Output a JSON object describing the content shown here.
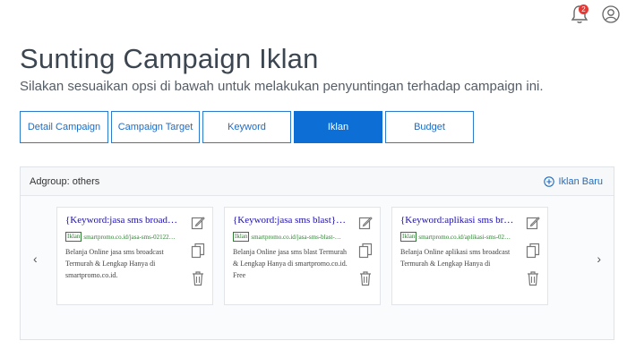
{
  "header": {
    "notification_count": "2",
    "icons": [
      "bell-icon",
      "user-icon"
    ]
  },
  "page": {
    "title": "Sunting Campaign Iklan",
    "subtitle": "Silakan sesuaikan opsi di bawah untuk melakukan penyuntingan terhadap campaign ini."
  },
  "tabs": [
    {
      "label": "Detail Campaign",
      "active": false
    },
    {
      "label": "Campaign Target",
      "active": false
    },
    {
      "label": "Keyword",
      "active": false
    },
    {
      "label": "Iklan",
      "active": true
    },
    {
      "label": "Budget",
      "active": false
    }
  ],
  "panel": {
    "adgroup_label": "Adgroup: others",
    "new_ad_label": "Iklan Baru",
    "prev_arrow": "‹",
    "next_arrow": "›"
  },
  "ads": [
    {
      "title": "{Keyword:jasa sms broadcas…",
      "tag": "Iklan",
      "url": "smartpromo.co.id/jasa-sms-02122…",
      "description": "Belanja Online jasa sms broadcast Termurah & Lengkap Hanya di smartpromo.co.id."
    },
    {
      "title": "{Keyword:jasa sms blast} - P…",
      "tag": "Iklan",
      "url": "smartpromo.co.id/jasa-sms-blast-…",
      "description": "Belanja Online jasa sms blast Termurah & Lengkap Hanya di smartpromo.co.id. Free"
    },
    {
      "title": "{Keyword:aplikasi sms broa…",
      "tag": "Iklan",
      "url": "smartpromo.co.id/aplikasi-sms-02…",
      "description": "Belanja Online aplikasi sms broadcast Termurah & Lengkap Hanya di"
    }
  ],
  "colors": {
    "accent": "#0d6fd6",
    "link_blue": "#1a0dab",
    "url_green": "#2e7d32",
    "badge_red": "#e53935"
  }
}
